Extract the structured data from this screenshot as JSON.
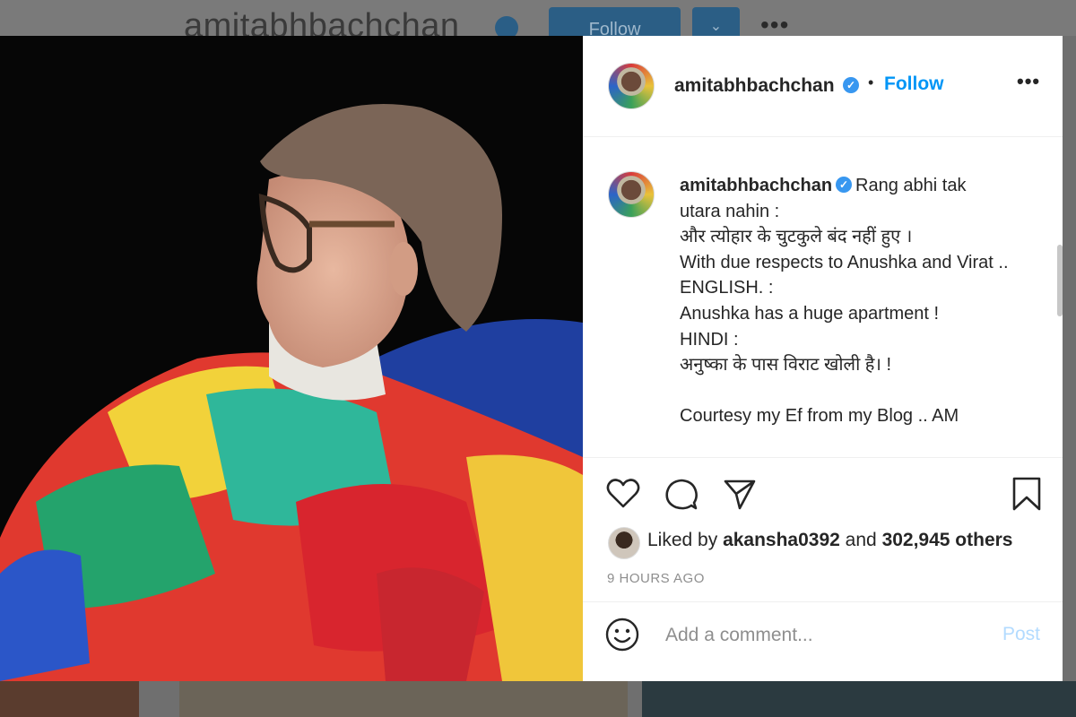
{
  "background": {
    "username": "amitabhbachchan",
    "follow_label": "Follow",
    "dropdown_icon": "chevron-down-icon",
    "more_icon": "more-horizontal-icon"
  },
  "post": {
    "photo_description_icon": "photo",
    "header": {
      "username": "amitabhbachchan",
      "verified": true,
      "separator": "•",
      "follow_label": "Follow",
      "more_label": "•••"
    },
    "caption": {
      "username": "amitabhbachchan",
      "text": "Rang abhi tak utara nahin :\nऔर त्योहार के चुटकुले बंद नहीं हुए ।\nWith due respects to Anushka and Virat ..\nENGLISH. :\nAnushka has a huge apartment !\nHINDI :\nअनुष्का के पास विराट खोली है। !\n\nCourtesy my Ef from my Blog .. AM"
    },
    "actions": {
      "like_icon": "heart-icon",
      "comment_icon": "comment-icon",
      "share_icon": "share-icon",
      "save_icon": "bookmark-icon"
    },
    "likes": {
      "prefix": "Liked by ",
      "user": "akansha0392",
      "middle": " and ",
      "count": "302,945 others"
    },
    "time_ago": "9 HOURS AGO",
    "comment": {
      "placeholder": "Add a comment...",
      "post_label": "Post"
    }
  },
  "colors": {
    "accent": "#0095f6",
    "verified": "#3897f0",
    "post_disabled": "#b3dbff"
  }
}
